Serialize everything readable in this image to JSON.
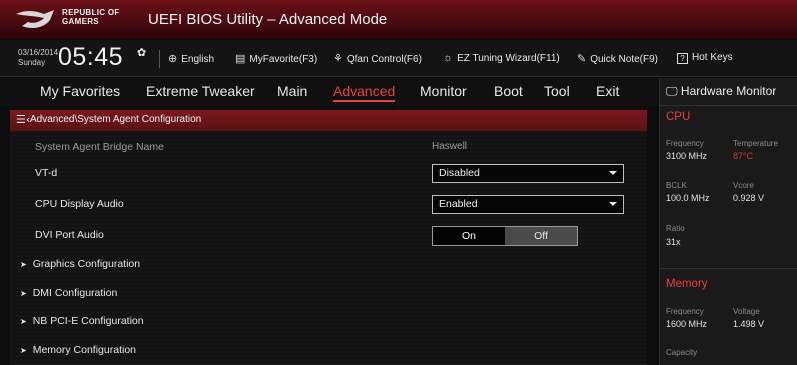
{
  "header": {
    "brand_line1": "REPUBLIC OF",
    "brand_line2": "GAMERS",
    "title": "UEFI BIOS Utility – Advanced Mode"
  },
  "infobar": {
    "date": "03/16/2014",
    "day": "Sunday",
    "time": "05:45",
    "language": "English",
    "myfavorite": "MyFavorite(F3)",
    "qfan": "Qfan Control(F6)",
    "ez_tuning": "EZ Tuning Wizard(F11)",
    "quick_note": "Quick Note(F9)",
    "hot_keys": "Hot Keys",
    "hot_keys_glyph": "?"
  },
  "menu": {
    "items": [
      "My Favorites",
      "Extreme Tweaker",
      "Main",
      "Advanced",
      "Monitor",
      "Boot",
      "Tool",
      "Exit"
    ],
    "active": "Advanced"
  },
  "breadcrumb": "Advanced\\System Agent Configuration",
  "settings": {
    "bridge_name_label": "System Agent Bridge Name",
    "bridge_name_value": "Haswell",
    "vtd_label": "VT-d",
    "vtd_value": "Disabled",
    "cpu_audio_label": "CPU Display Audio",
    "cpu_audio_value": "Enabled",
    "dvi_audio_label": "DVI Port Audio",
    "dvi_on": "On",
    "dvi_off": "Off",
    "dvi_selected": "On",
    "submenus": [
      "Graphics Configuration",
      "DMI Configuration",
      "NB PCI-E Configuration",
      "Memory Configuration"
    ]
  },
  "hardware_monitor": {
    "title": "Hardware Monitor",
    "cpu": {
      "section": "CPU",
      "frequency_label": "Frequency",
      "frequency": "3100 MHz",
      "temperature_label": "Temperature",
      "temperature": "87°C",
      "bclk_label": "BCLK",
      "bclk": "100.0 MHz",
      "vcore_label": "Vcore",
      "vcore": "0.928 V",
      "ratio_label": "Ratio",
      "ratio": "31x"
    },
    "memory": {
      "section": "Memory",
      "frequency_label": "Frequency",
      "frequency": "1600 MHz",
      "voltage_label": "Voltage",
      "voltage": "1.498 V",
      "capacity_label": "Capacity"
    }
  },
  "colors": {
    "accent": "#e8423f",
    "title_bar": "#6a1018",
    "breadcrumb": "#7a1a1e",
    "background": "#0d0d0d"
  }
}
